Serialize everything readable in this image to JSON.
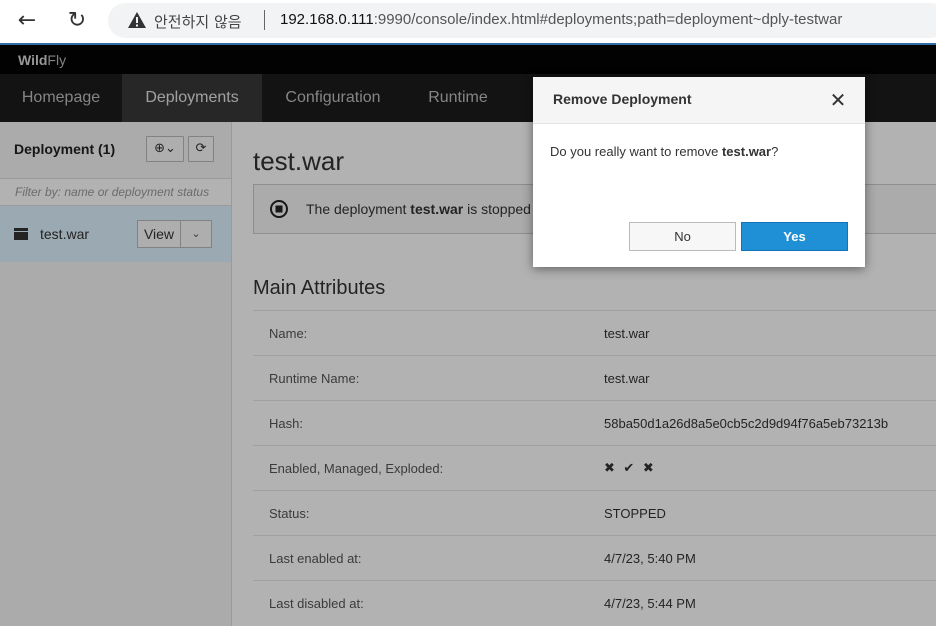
{
  "browser": {
    "back_glyph": "←",
    "reload_glyph": "↻",
    "security_text": "안전하지 않음",
    "url_host": "192.168.0.111",
    "url_rest": ":9990/console/index.html#deployments;path=deployment~dply-testwar"
  },
  "app": {
    "brand_bold": "Wild",
    "brand_light": "Fly",
    "nav": [
      "Homepage",
      "Deployments",
      "Configuration",
      "Runtime"
    ],
    "active_nav": "Deployments"
  },
  "sidebar": {
    "title": "Deployment (1)",
    "add_glyph": "⊕⌄",
    "refresh_glyph": "⟳",
    "filter_placeholder": "Filter by: name or deployment status",
    "item_name": "test.war",
    "view_label": "View",
    "caret_glyph": "⌄"
  },
  "main": {
    "title": "test.war",
    "alert_prefix": "The deployment ",
    "alert_name": "test.war",
    "alert_suffix": " is stopped",
    "section_title": "Main Attributes",
    "attributes": [
      {
        "label": "Name:",
        "value": "test.war"
      },
      {
        "label": "Runtime Name:",
        "value": "test.war"
      },
      {
        "label": "Hash:",
        "value": "58ba50d1a26d8a5e0cb5c2d9d94f76a5eb73213b"
      },
      {
        "label": "Enabled, Managed, Exploded:",
        "value": "✖ ✔ ✖"
      },
      {
        "label": "Status:",
        "value": "STOPPED"
      },
      {
        "label": "Last enabled at:",
        "value": "4/7/23, 5:40 PM"
      },
      {
        "label": "Last disabled at:",
        "value": "4/7/23, 5:44 PM"
      }
    ]
  },
  "modal": {
    "title": "Remove Deployment",
    "close_glyph": "✕",
    "message_prefix": "Do you really want to remove ",
    "message_name": "test.war",
    "message_suffix": "?",
    "no_label": "No",
    "yes_label": "Yes"
  },
  "colors": {
    "primary": "#1f8fd6",
    "selected_row": "#def3ff",
    "nav_bg": "#1c1c1c"
  }
}
